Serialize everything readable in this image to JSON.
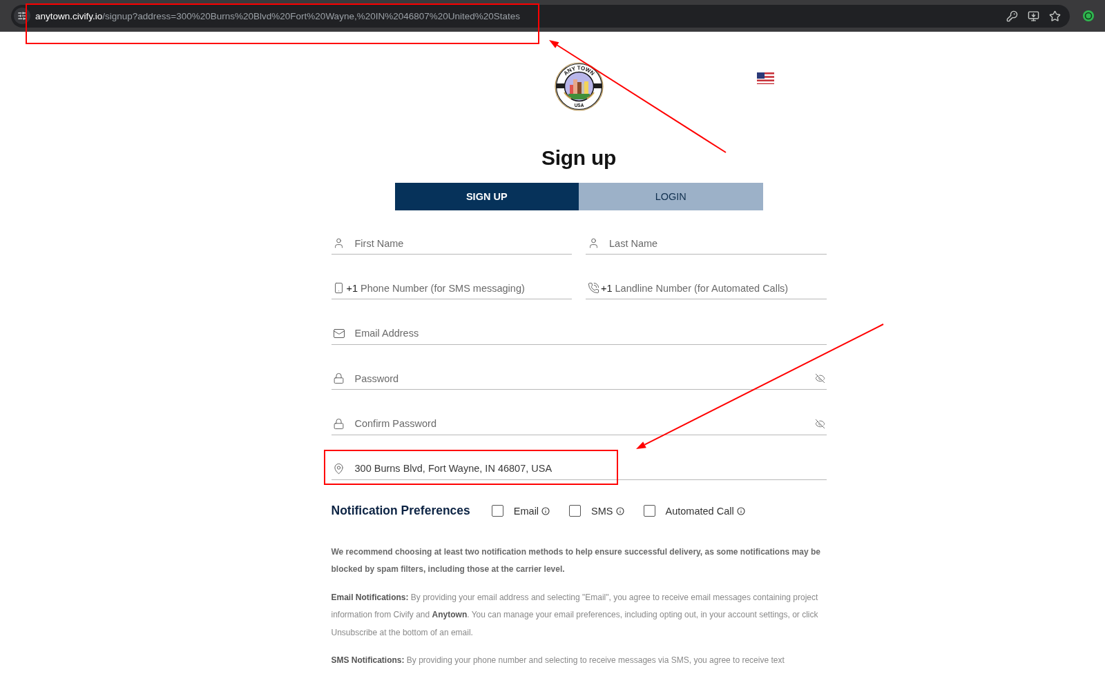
{
  "browser": {
    "url": {
      "host": "anytown.civify.io",
      "path": "/signup?address=300%20Burns%20Blvd%20Fort%20Wayne,%20IN%2046807%20United%20States"
    }
  },
  "logo": {
    "top_text": "ANY TOWN",
    "bottom_text": "USA"
  },
  "title": "Sign up",
  "tabs": [
    {
      "label": "SIGN UP",
      "selected": true
    },
    {
      "label": "LOGIN",
      "selected": false
    }
  ],
  "form": {
    "rows": [
      {
        "fields": [
          {
            "kind": "name",
            "placeholder": "First Name"
          },
          {
            "kind": "name",
            "placeholder": "Last Name"
          }
        ]
      },
      {
        "fields": [
          {
            "kind": "mobile",
            "prefix": "+1",
            "placeholder": "Phone Number (for SMS messaging)"
          },
          {
            "kind": "landline",
            "prefix": "+1",
            "placeholder": "Landline Number (for Automated Calls)"
          }
        ]
      },
      {
        "fields": [
          {
            "kind": "email",
            "placeholder": "Email Address"
          }
        ]
      },
      {
        "fields": [
          {
            "kind": "password",
            "placeholder": "Password"
          }
        ]
      },
      {
        "fields": [
          {
            "kind": "password",
            "placeholder": "Confirm Password"
          }
        ]
      },
      {
        "fields": [
          {
            "kind": "address",
            "value": "300 Burns Blvd, Fort Wayne, IN 46807, USA"
          }
        ]
      }
    ]
  },
  "notification_preferences": {
    "title": "Notification Preferences",
    "options": [
      {
        "label": "Email",
        "checked": false
      },
      {
        "label": "SMS",
        "checked": false
      },
      {
        "label": "Automated Call",
        "checked": false
      }
    ]
  },
  "notices": [
    {
      "kind": "emphasis",
      "text": "We recommend choosing at least two notification methods to help ensure successful delivery, as some notifications may be blocked by spam filters, including those at the carrier level."
    },
    {
      "kind": "plain",
      "text": "**Email Notifications:** By providing your email address and selecting \"Email\", you agree to receive email messages containing project information from Civify and **Anytown**. You can manage your email preferences, including opting out, in your account settings, or click Unsubscribe at the bottom of an email."
    },
    {
      "kind": "plain",
      "text": "**SMS Notifications:** By providing your phone number and selecting to receive messages via SMS, you agree to receive text"
    }
  ]
}
